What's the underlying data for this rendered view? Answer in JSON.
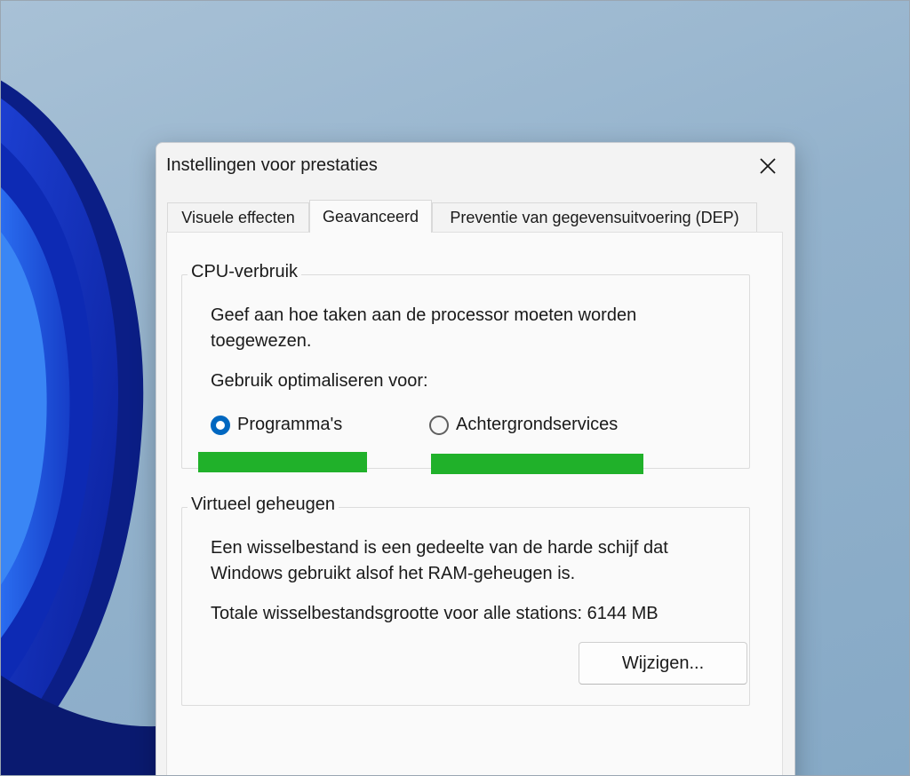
{
  "dialog": {
    "title": "Instellingen voor prestaties"
  },
  "tabs": [
    {
      "label": "Visuele effecten",
      "active": false
    },
    {
      "label": "Geavanceerd",
      "active": true
    },
    {
      "label": "Preventie van gegevensuitvoering (DEP)",
      "active": false
    }
  ],
  "cpu": {
    "title": "CPU-verbruik",
    "description_line1": "Geef aan hoe taken aan de processor moeten worden",
    "description_line2": "toegewezen.",
    "optimize_label": "Gebruik optimaliseren voor:",
    "options": [
      {
        "label": "Programma's",
        "selected": true
      },
      {
        "label": "Achtergrondservices",
        "selected": false
      }
    ]
  },
  "virtual_memory": {
    "title": "Virtueel geheugen",
    "description_line1": "Een wisselbestand is een gedeelte van de harde schijf dat",
    "description_line2": "Windows gebruikt alsof het RAM-geheugen is.",
    "total_label": "Totale wisselbestandsgrootte voor alle stations:",
    "total_value": "6144 MB",
    "change_button": "Wijzigen..."
  },
  "colors": {
    "accent": "#0067c0",
    "highlight": "#20b12a",
    "dialog_bg": "#f3f3f3",
    "desktop_bg": "#93b2cc"
  }
}
